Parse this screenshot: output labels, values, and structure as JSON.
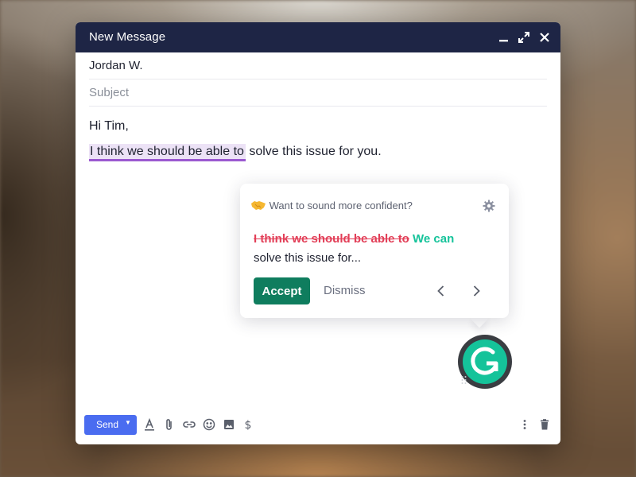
{
  "window": {
    "title": "New Message",
    "buttons": [
      "minimize-icon",
      "expand-icon",
      "close-icon"
    ]
  },
  "compose": {
    "to_value": "Jordan W.",
    "subject_placeholder": "Subject",
    "body": {
      "greeting": "Hi Tim,",
      "highlighted_text": "I think we should be able to",
      "rest_text": " solve this issue for you."
    }
  },
  "suggestion": {
    "header_icon": "handshake-emoji",
    "header": "Want to sound more confident?",
    "removed_text": "I think we should be able to",
    "inserted_text": "We can",
    "continuation": "solve this issue for...",
    "accept_label": "Accept",
    "dismiss_label": "Dismiss",
    "accent_color": "#15c39a",
    "remove_color": "#e23e57",
    "accept_color": "#0f7d5e"
  },
  "toolbar": {
    "send_label": "Send",
    "send_color": "#4a6cf0",
    "tools": [
      "text-format-icon",
      "attach-icon",
      "link-icon",
      "emoji-icon",
      "image-icon",
      "dollar-icon",
      "more-icon",
      "trash-icon"
    ]
  },
  "colors": {
    "titlebar": "#1e2545",
    "highlight_bg": "#ece2f6",
    "highlight_underline": "#9b59d0"
  }
}
